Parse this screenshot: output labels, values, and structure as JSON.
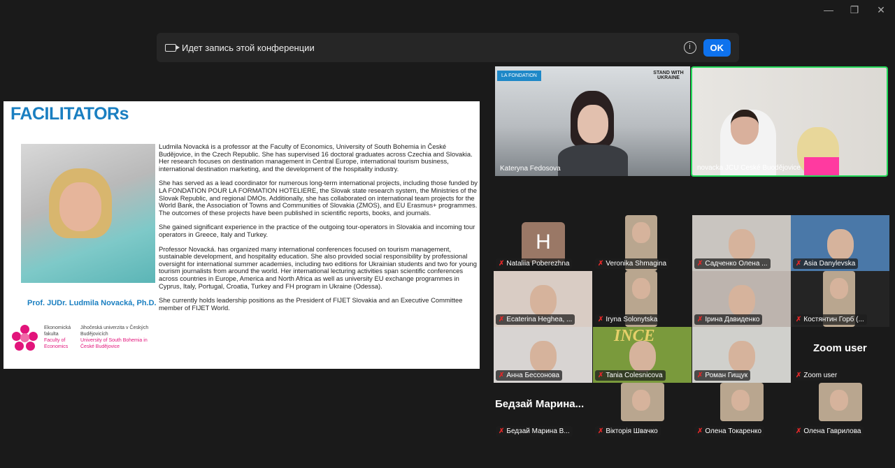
{
  "window": {
    "minimize": "—",
    "restore": "❐",
    "close": "✕"
  },
  "banner": {
    "text": "Идет запись этой конференции",
    "ok": "OK"
  },
  "slide": {
    "title": "FACILITATORs",
    "caption": "Prof. JUDr. Ludmila Novacká, Ph.D.",
    "logo": {
      "faculty_cz": "Ekonomická fakulta",
      "faculty_en": "Faculty of Economics",
      "uni_cz": "Jihočeská univerzita v Českých Budějovicích",
      "uni_en": "University of South Bohemia in České Budějovice"
    },
    "paragraphs": [
      "Ludmila Novacká is a professor at the Faculty of Economics, University of South Bohemia in České Budějovice, in the Czech Republic. She has supervised 16 doctoral graduates across Czechia and Slovakia. Her research focuses on destination management in Central Europe, international tourism business, international destination marketing, and the development of the hospitality industry.",
      "She has served as a lead coordinator for numerous long-term international projects, including those funded by LA FONDATION POUR LA FORMATION HOTELIERE, the Slovak state research system, the Ministries of the Slovak Republic, and regional DMOs. Additionally, she has collaborated on international team projects for the World Bank, the Association of Towns and Communities of Slovakia (ZMOS), and EU Erasmus+ programmes. The outcomes of these projects have been published in scientific reports, books, and journals.",
      "She gained significant experience in the practice of the outgoing tour-operators in Slovakia and incoming tour operators in Greece, Italy and Turkey.",
      "Professor Novacká. has organized many international conferences focused on tourism management, sustainable development, and hospitality education. She also provided social responsibility by professional oversight for international summer academies, including two editions for Ukrainian students and two for young tourism journalists from around the world. Her international lecturing activities span scientific conferences across countries in Europe, America and North Africa as well as university EU exchange programmes in Cyprus, Italy, Portugal, Croatia, Turkey and FH program in Ukraine (Odessa).",
      "She currently holds leadership positions as the President of FIJET Slovakia and an Executive Committee member of FIJET World."
    ]
  },
  "top_videos": [
    {
      "name": "Kateryna Fedosova",
      "overlay_left": "LA FONDATION",
      "overlay_right": "STAND WITH UKRAINE"
    },
    {
      "name": "novacka JCU Ceské Buodějovice",
      "active_speaker": true
    }
  ],
  "participants": [
    {
      "name": "Nataliia Poberezhna",
      "avatar": "H"
    },
    {
      "name": "Veronika Shmagina"
    },
    {
      "name": "Садченко Олена ..."
    },
    {
      "name": "Asia Danylevska"
    },
    {
      "name": "Ecaterina Heghea, ..."
    },
    {
      "name": "Iryna Solonytska"
    },
    {
      "name": "Ірина Давиденко"
    },
    {
      "name": "Костянтин Горб (..."
    },
    {
      "name": "Анна Бессонова"
    },
    {
      "name": "Tania Colesnicova",
      "bg_text": "INCE"
    },
    {
      "name": "Роман Гищук"
    },
    {
      "name": "Zoom user",
      "big": "Zoom user"
    },
    {
      "name": "Бедзай Марина В...",
      "big": "Бедзай  Марина..."
    },
    {
      "name": "Вікторія Швачко"
    },
    {
      "name": "Олена Токаренко"
    },
    {
      "name": "Олена Гаврилова"
    }
  ],
  "mic_icon": "muted-mic-icon",
  "colors": {
    "ok": "#0e72ed",
    "speaker_border": "#23d959",
    "slide_title": "#1a7fc1",
    "logo": "#e2147b"
  }
}
